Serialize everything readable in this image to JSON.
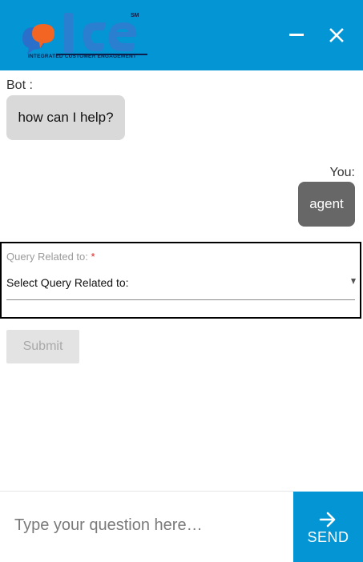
{
  "header": {
    "logo_text": "INTEGRATED CUSTOMER ENGAGEMENT",
    "logo_mark": "SM",
    "minimize_icon": "minimize-icon",
    "close_icon": "close-icon",
    "brand_color": "#0395d4"
  },
  "messages": {
    "bot_label": "Bot :",
    "bot_text": "how can I help?",
    "user_label": "You:",
    "user_text": "agent"
  },
  "form": {
    "field_label": "Query Related to:",
    "required_mark": "*",
    "selected_value": "Select Query Related to:",
    "submit_label": "Submit"
  },
  "composer": {
    "placeholder": "Type your question here…",
    "send_label": "SEND",
    "send_icon": "arrow-right-icon"
  }
}
